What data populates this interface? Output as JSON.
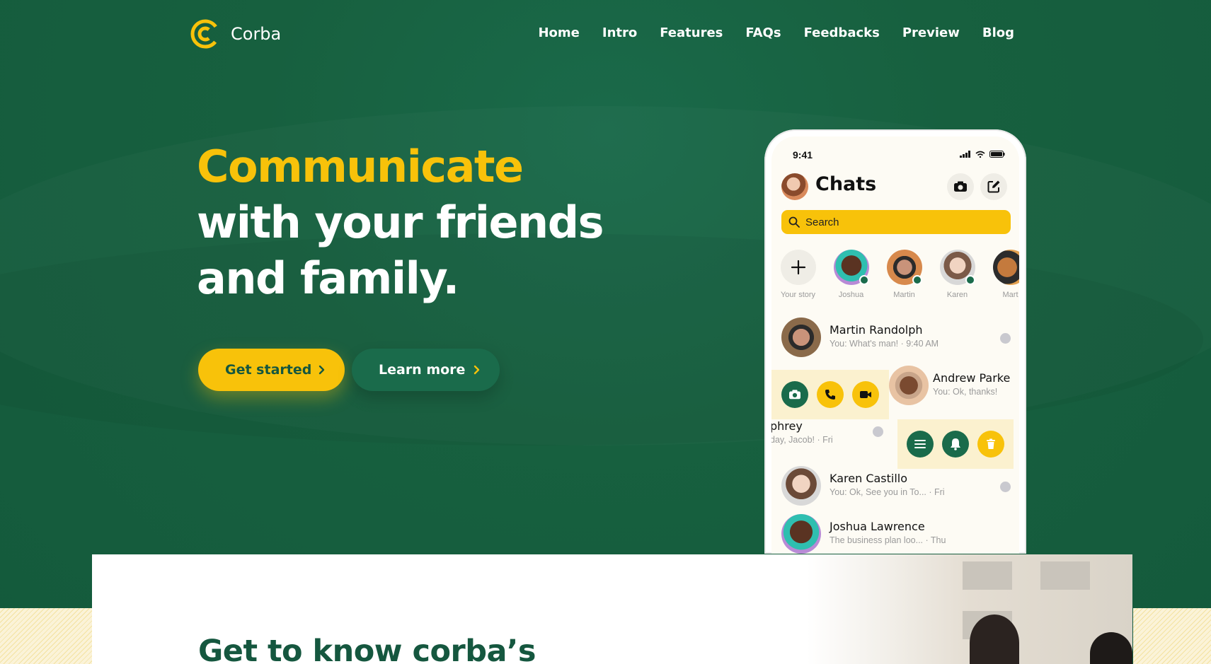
{
  "brand": {
    "name": "Corba"
  },
  "nav": {
    "items": [
      "Home",
      "Intro",
      "Features",
      "FAQs",
      "Feedbacks",
      "Preview",
      "Blog"
    ]
  },
  "hero": {
    "line1": "Communicate",
    "line2": "with your friends",
    "line3": "and family.",
    "primary_button": "Get started",
    "secondary_button": "Learn more"
  },
  "phone": {
    "time": "9:41",
    "title": "Chats",
    "search_placeholder": "Search",
    "stories": [
      "Your story",
      "Joshua",
      "Martin",
      "Karen",
      "Mart"
    ],
    "chats": [
      {
        "name": "Martin Randolph",
        "preview": "You: What's man! · 9:40 AM"
      },
      {
        "name": "Andrew Parke",
        "preview": "You: Ok, thanks!"
      },
      {
        "name": "phrey",
        "preview": "day, Jacob! · Fri"
      },
      {
        "name": "Karen Castillo",
        "preview": "You: Ok, See you in To... · Fri"
      },
      {
        "name": "Joshua Lawrence",
        "preview": "The business plan loo...  · Thu"
      }
    ]
  },
  "section": {
    "title": "Get to know corba’s"
  },
  "colors": {
    "green": "#15573f",
    "yellow": "#f8c20a",
    "white": "#ffffff"
  },
  "icons": [
    "corba-logo-icon",
    "chevron-right-icon",
    "camera-icon",
    "compose-icon",
    "search-icon",
    "plus-icon",
    "phone-icon",
    "video-icon",
    "menu-icon",
    "bell-icon",
    "trash-icon",
    "signal-icon",
    "wifi-icon",
    "battery-icon"
  ]
}
